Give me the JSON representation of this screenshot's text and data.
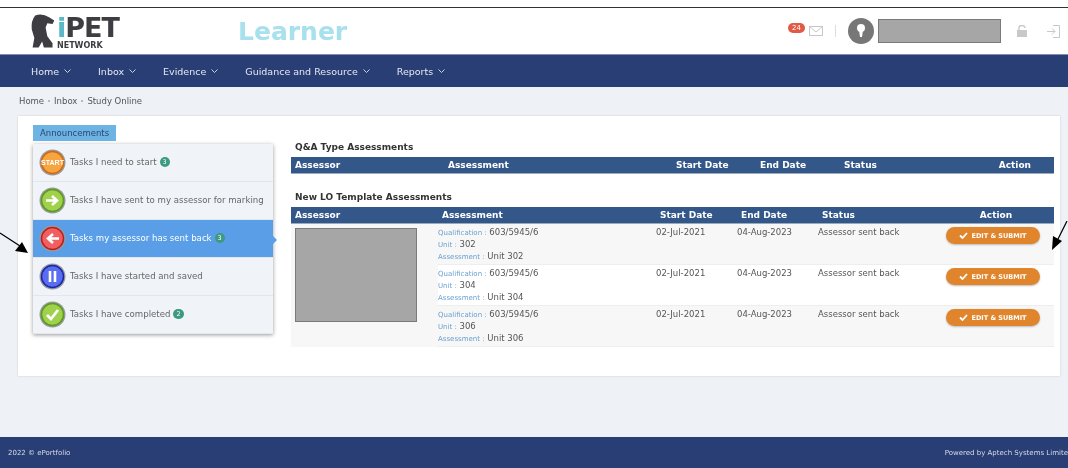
{
  "header": {
    "logo": {
      "accent": "i",
      "name": "PET",
      "subtitle": "NETWORK"
    },
    "role": "Learner",
    "mail_count": "24"
  },
  "nav": [
    {
      "label": "Home"
    },
    {
      "label": "Inbox"
    },
    {
      "label": "Evidence"
    },
    {
      "label": "Guidance and Resource"
    },
    {
      "label": "Reports"
    }
  ],
  "breadcrumb": [
    "Home",
    "Inbox",
    "Study Online"
  ],
  "announcements_tab": "Announcements",
  "task_menu": [
    {
      "kind": "start",
      "icon_label": "START",
      "label": "Tasks I need to start",
      "count": "3",
      "selected": false
    },
    {
      "kind": "forward",
      "label": "Tasks I have sent to my assessor for marking",
      "selected": false
    },
    {
      "kind": "back",
      "label": "Tasks my assessor has sent back",
      "count": "3",
      "selected": true
    },
    {
      "kind": "pause",
      "label": "Tasks I have started and saved",
      "selected": false
    },
    {
      "kind": "done",
      "label": "Tasks I have completed",
      "count": "2",
      "selected": false
    }
  ],
  "qa_table": {
    "title": "Q&A Type Assessments",
    "columns": [
      "Assessor",
      "Assessment",
      "Start Date",
      "End Date",
      "Status",
      "Action"
    ]
  },
  "lo_table": {
    "title": "New LO Template Assessments",
    "columns": [
      "Assessor",
      "Assessment",
      "Start Date",
      "End Date",
      "Status",
      "Action"
    ],
    "rows": [
      {
        "qualification_label": "Qualification :",
        "qualification": "603/5945/6",
        "unit_label": "Unit :",
        "unit": "302",
        "assessment_label": "Assessment :",
        "assessment": "Unit 302",
        "start_date": "02-Jul-2021",
        "end_date": "04-Aug-2023",
        "status": "Assessor sent back",
        "action": "EDIT & SUBMIT"
      },
      {
        "qualification_label": "Qualification :",
        "qualification": "603/5945/6",
        "unit_label": "Unit :",
        "unit": "304",
        "assessment_label": "Assessment :",
        "assessment": "Unit 304",
        "start_date": "02-Jul-2021",
        "end_date": "04-Aug-2023",
        "status": "Assessor sent back",
        "action": "EDIT & SUBMIT"
      },
      {
        "qualification_label": "Qualification :",
        "qualification": "603/5945/6",
        "unit_label": "Unit :",
        "unit": "306",
        "assessment_label": "Assessment :",
        "assessment": "Unit 306",
        "start_date": "02-Jul-2021",
        "end_date": "04-Aug-2023",
        "status": "Assessor sent back",
        "action": "EDIT & SUBMIT"
      }
    ]
  },
  "footer": {
    "copyright": "2022 © ePortfolio",
    "powered_by": "Powered by Aptech Systems Limite"
  }
}
